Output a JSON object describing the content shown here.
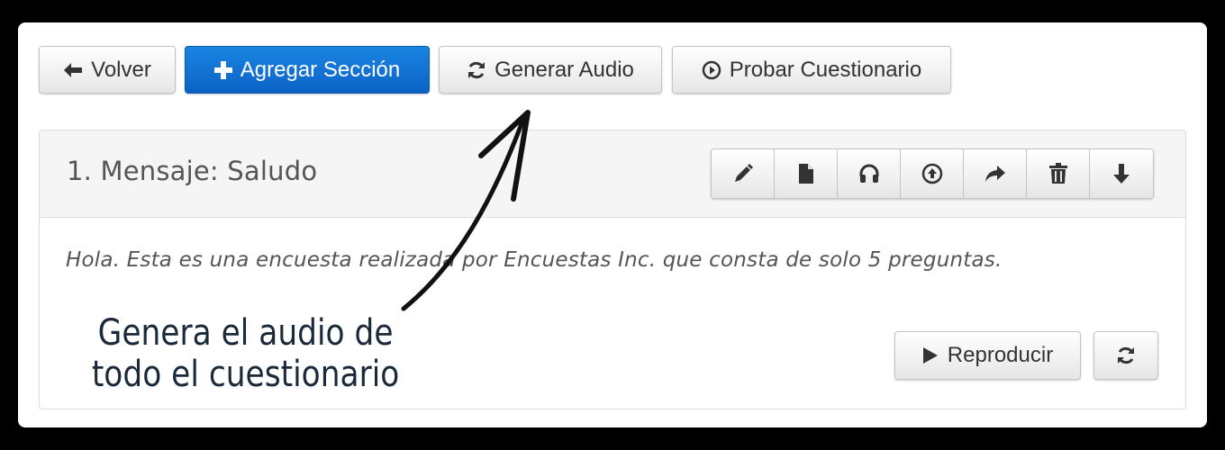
{
  "toolbar": {
    "back_label": "Volver",
    "add_section_label": "Agregar Sección",
    "generate_audio_label": "Generar Audio",
    "test_questionnaire_label": "Probar Cuestionario"
  },
  "section": {
    "title": "1. Mensaje: Saludo",
    "message": "Hola. Esta es una encuesta realizada por Encuestas Inc. que consta de solo 5 preguntas.",
    "actions": [
      "pencil-icon",
      "file-icon",
      "headphones-icon",
      "upload-circle-icon",
      "share-icon",
      "trash-icon",
      "arrow-down-icon"
    ],
    "play_label": "Reproducir"
  },
  "annotation": {
    "line1": "Genera el audio de",
    "line2": "todo el cuestionario"
  },
  "colors": {
    "primary": "#0b62c6",
    "annotation_text": "#1b2a3b",
    "background": "#000000"
  }
}
